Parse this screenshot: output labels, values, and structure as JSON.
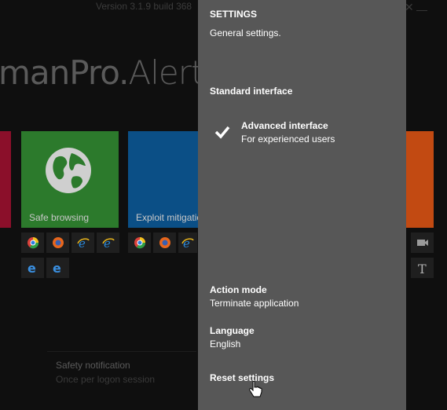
{
  "app": {
    "version": "Version 3.1.9 build 368",
    "brand_main": "manPro",
    "brand_dot": ".",
    "brand_sub": "Alert",
    "minimize": "—",
    "close": "✕"
  },
  "tiles": [
    {
      "label": "",
      "color": "#8b0f2a"
    },
    {
      "label": "Safe browsing",
      "color": "#2c7a2c",
      "icon": "globe-icon"
    },
    {
      "label": "Exploit mitigation",
      "color": "#0b4f86"
    },
    {
      "label": "",
      "color": "#c24a12"
    }
  ],
  "browser_icons": [
    "chrome-icon",
    "firefox-icon",
    "ie-icon",
    "ie-icon",
    "edge-icon",
    "edge-icon",
    "chrome-icon",
    "firefox-icon",
    "ie-icon",
    "camera-icon",
    "text-icon"
  ],
  "safety": {
    "title": "Safety notification",
    "subtitle": "Once per logon session"
  },
  "settings": {
    "title": "SETTINGS",
    "description": "General settings.",
    "standard_interface": "Standard interface",
    "advanced_interface": "Advanced interface",
    "advanced_desc": "For experienced users",
    "action_mode_label": "Action mode",
    "action_mode_value": "Terminate application",
    "language_label": "Language",
    "language_value": "English",
    "reset": "Reset settings"
  },
  "colors": {
    "panel": "#575757",
    "background": "#0f0f0f"
  }
}
